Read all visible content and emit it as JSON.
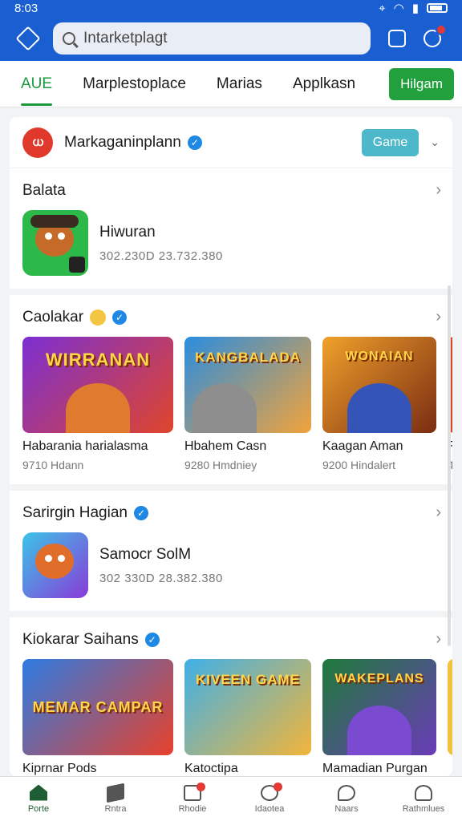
{
  "status": {
    "time": "8:03"
  },
  "search": {
    "value": "Intarketplagt"
  },
  "tabs": [
    {
      "label": "AUE",
      "active": true
    },
    {
      "label": "Marplestoplace"
    },
    {
      "label": "Marias"
    },
    {
      "label": "Applkasn"
    }
  ],
  "tab_button": "Hilgam",
  "header": {
    "brand_logo_text": "ധ",
    "brand_name": "Markaganinplann",
    "pill": "Game"
  },
  "sections": {
    "s1": {
      "title": "Balata",
      "app_name": "Hiwuran",
      "app_meta": "302.230D 23.732.380"
    },
    "s2": {
      "title": "Caolakar",
      "cards": [
        {
          "thumb_text": "WIRRANAN",
          "title": "Habarania harialasma",
          "meta": "9710 Hdann"
        },
        {
          "thumb_text": "KANGBALADA",
          "title": "Hbahem Casn",
          "meta": "9280 Hmdniey"
        },
        {
          "thumb_text": "WONAIAN",
          "title": "Kaagan Aman",
          "meta": "9200 Hindalert"
        },
        {
          "thumb_text": "",
          "title": "F",
          "meta": "4"
        }
      ]
    },
    "s3": {
      "title": "Sarirgin Hagian",
      "app_name": "Samocr SolM",
      "app_meta": "302 330D 28.382.380"
    },
    "s4": {
      "title": "Kiokarar Saihans",
      "cards": [
        {
          "thumb_text": "MEMAR CAMPAR",
          "title": "Kiprnar Pods"
        },
        {
          "thumb_text": "KIVEEN GAME",
          "title": "Katoctipa"
        },
        {
          "thumb_text": "WAKEPLANS",
          "title": "Mamadian Purgan"
        },
        {
          "thumb_text": "",
          "title": ""
        }
      ]
    }
  },
  "bottom_nav": [
    {
      "label": "Porte",
      "icon": "home-icon",
      "active": true
    },
    {
      "label": "Rntra",
      "icon": "book-icon"
    },
    {
      "label": "Rhodie",
      "icon": "box-icon",
      "badge": true
    },
    {
      "label": "Idaotea",
      "icon": "ring-icon",
      "badge": true
    },
    {
      "label": "Naars",
      "icon": "chat-icon"
    },
    {
      "label": "Rathmlues",
      "icon": "user-icon"
    }
  ],
  "colors": {
    "brand_blue": "#1a5fd1",
    "accent_green": "#21a03d",
    "verify_blue": "#1e88e5",
    "pill_teal": "#4cb8c9"
  }
}
